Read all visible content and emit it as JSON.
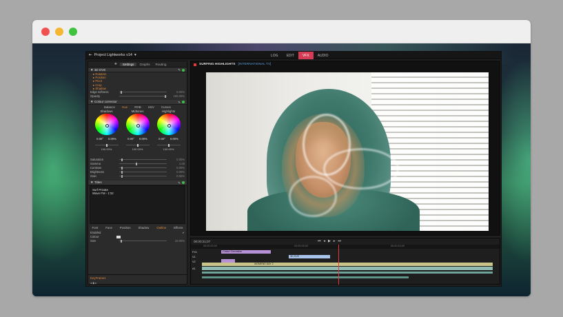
{
  "app": {
    "project": "Project Lightworks v14",
    "top_tabs": [
      "LOG",
      "EDIT",
      "VFX",
      "AUDIO"
    ],
    "active_top_tab": "VFX",
    "left_tabs": [
      "Settings",
      "Graphs",
      "Routing"
    ],
    "active_left_tab": "Settings"
  },
  "effects": {
    "dve_title": "3D DVE",
    "dve_items": [
      "Rotation",
      "Position",
      "Pivot",
      "Crop",
      "Shadow"
    ],
    "edge_softness_label": "Edge softness",
    "edge_softness_value": "0.00%",
    "opacity_label": "Opacity",
    "opacity_value": "100.00%",
    "colour_corrector_title": "Colour corrector",
    "cc_tabs": [
      "Balance",
      "Hue",
      "RGB",
      "HSV",
      "Curves"
    ],
    "cc_selected": "Hue",
    "wheels": [
      {
        "name": "Shadows",
        "v1": "0.00°",
        "v2": "0.00%",
        "pct": "100.00%"
      },
      {
        "name": "Midtones",
        "v1": "0.00°",
        "v2": "0.00%",
        "pct": "100.00%"
      },
      {
        "name": "Highlights",
        "v1": "0.00°",
        "v2": "0.00%",
        "pct": "100.00%"
      }
    ],
    "params": [
      {
        "label": "Saturation",
        "value": "0.00%"
      },
      {
        "label": "Gamma",
        "value": "1.00"
      },
      {
        "label": "Contrast",
        "value": "0.00%"
      },
      {
        "label": "Brightness",
        "value": "0.00%"
      },
      {
        "label": "Gain",
        "value": "0.00%"
      }
    ],
    "titles_section": "Titles",
    "title_text_line1": "Surf Private",
    "title_text_line2": "Wave FM - 1'32",
    "text_tabs": [
      "Font",
      "Face",
      "Position",
      "Shadow",
      "Outline",
      "Effects"
    ],
    "text_selected": "Outline",
    "enabled_label": "Enabled",
    "colour_label": "Colour",
    "size_label": "Size",
    "size_value": "10.00%",
    "footer_label": "KeyFrames"
  },
  "viewer": {
    "clip_title": "SURFING HIGHLIGHTS",
    "clip_sub": "[INTERNATIONAL TV]",
    "timecode": "00:00:21;07"
  },
  "timeline": {
    "ruler": [
      "00:00:00;00",
      "00:00:05;00",
      "00:00:10;00"
    ],
    "tracks": [
      {
        "label": "FX1",
        "clip": "Colour Correction",
        "color": "#b791d6"
      },
      {
        "label": "V1",
        "clip": "3D DVE",
        "color": "#a9c4ea"
      },
      {
        "label": "V2",
        "clip": "WOMENS DAY 2",
        "color": "#c9c58a"
      },
      {
        "label": "A1",
        "clip": "",
        "color": "#8fbbb2"
      }
    ]
  }
}
